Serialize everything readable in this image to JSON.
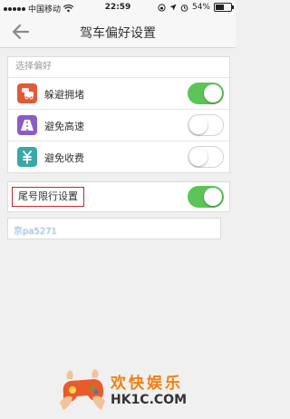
{
  "status_bar": {
    "carrier": "中国移动",
    "time": "22:59",
    "battery_text": "54%",
    "battery_level": 0.54
  },
  "nav": {
    "title": "驾车偏好设置"
  },
  "preferences": {
    "header": "选择偏好",
    "items": [
      {
        "label": "躲避拥堵",
        "icon": "traffic-car-icon",
        "icon_color": "#e05a3a",
        "enabled": true
      },
      {
        "label": "避免高速",
        "icon": "highway-icon",
        "icon_color": "#8a5cc8",
        "enabled": false
      },
      {
        "label": "避免收费",
        "icon": "toll-money-icon",
        "icon_color": "#3aa8a8",
        "enabled": false
      }
    ]
  },
  "plate_restriction": {
    "label": "尾号限行设置",
    "enabled": true,
    "plate_value": "京pa5271"
  },
  "watermark": {
    "title": "欢快娱乐",
    "site": "HK1C.COM"
  },
  "colors": {
    "toggle_on": "#5cc458",
    "highlight_border": "#c62828",
    "watermark_orange": "#f08010"
  }
}
